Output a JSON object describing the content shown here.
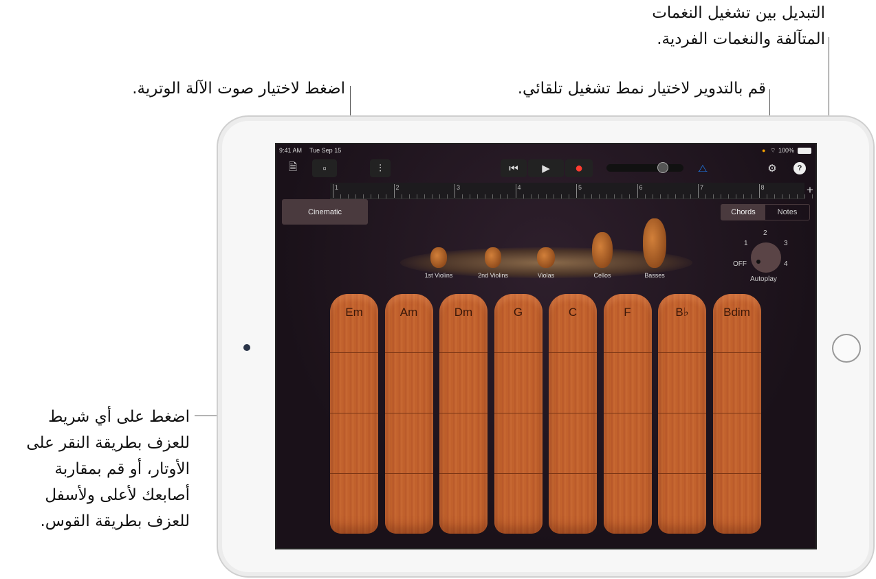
{
  "callouts": {
    "notes_chords": [
      "التبديل بين تشغيل النغمات",
      "المتآلفة والنغمات الفردية."
    ],
    "autoplay": "قم بالتدوير لاختيار نمط تشغيل تلقائي.",
    "sound": "اضغط لاختيار صوت الآلة الوترية.",
    "strips": [
      "اضغط على أي شريط",
      "للعزف بطريقة النقر على",
      "الأوتار، أو قم بمقاربة",
      "أصابعك لأعلى ولأسفل",
      "للعزف بطريقة القوس."
    ]
  },
  "status": {
    "time": "9:41 AM",
    "date": "Tue Sep 15",
    "battery": "100%"
  },
  "toolbar": {
    "icons": [
      "document-icon",
      "view-toggle-icon",
      "mixer-icon",
      "rewind-icon",
      "play-icon",
      "record-icon",
      "metronome-icon",
      "settings-icon",
      "help-icon"
    ],
    "help": "?",
    "add": "+",
    "volume": 0.8
  },
  "ruler": {
    "bars": [
      "1",
      "2",
      "3",
      "4",
      "5",
      "6",
      "7",
      "8"
    ]
  },
  "sound_button": "Cinematic",
  "mode": {
    "options": [
      "Chords",
      "Notes"
    ],
    "selected": "Chords"
  },
  "instruments": [
    "1st Violins",
    "2nd Violins",
    "Violas",
    "Cellos",
    "Basses"
  ],
  "autoplay": {
    "label": "Autoplay",
    "positions": [
      "OFF",
      "1",
      "2",
      "3",
      "4"
    ],
    "value": "OFF"
  },
  "chords": [
    "Em",
    "Am",
    "Dm",
    "G",
    "C",
    "F",
    "B♭",
    "Bdim"
  ],
  "colors": {
    "record": "#ff3b30",
    "metronome": "#1e7cf0",
    "strip": "#c5652e"
  }
}
